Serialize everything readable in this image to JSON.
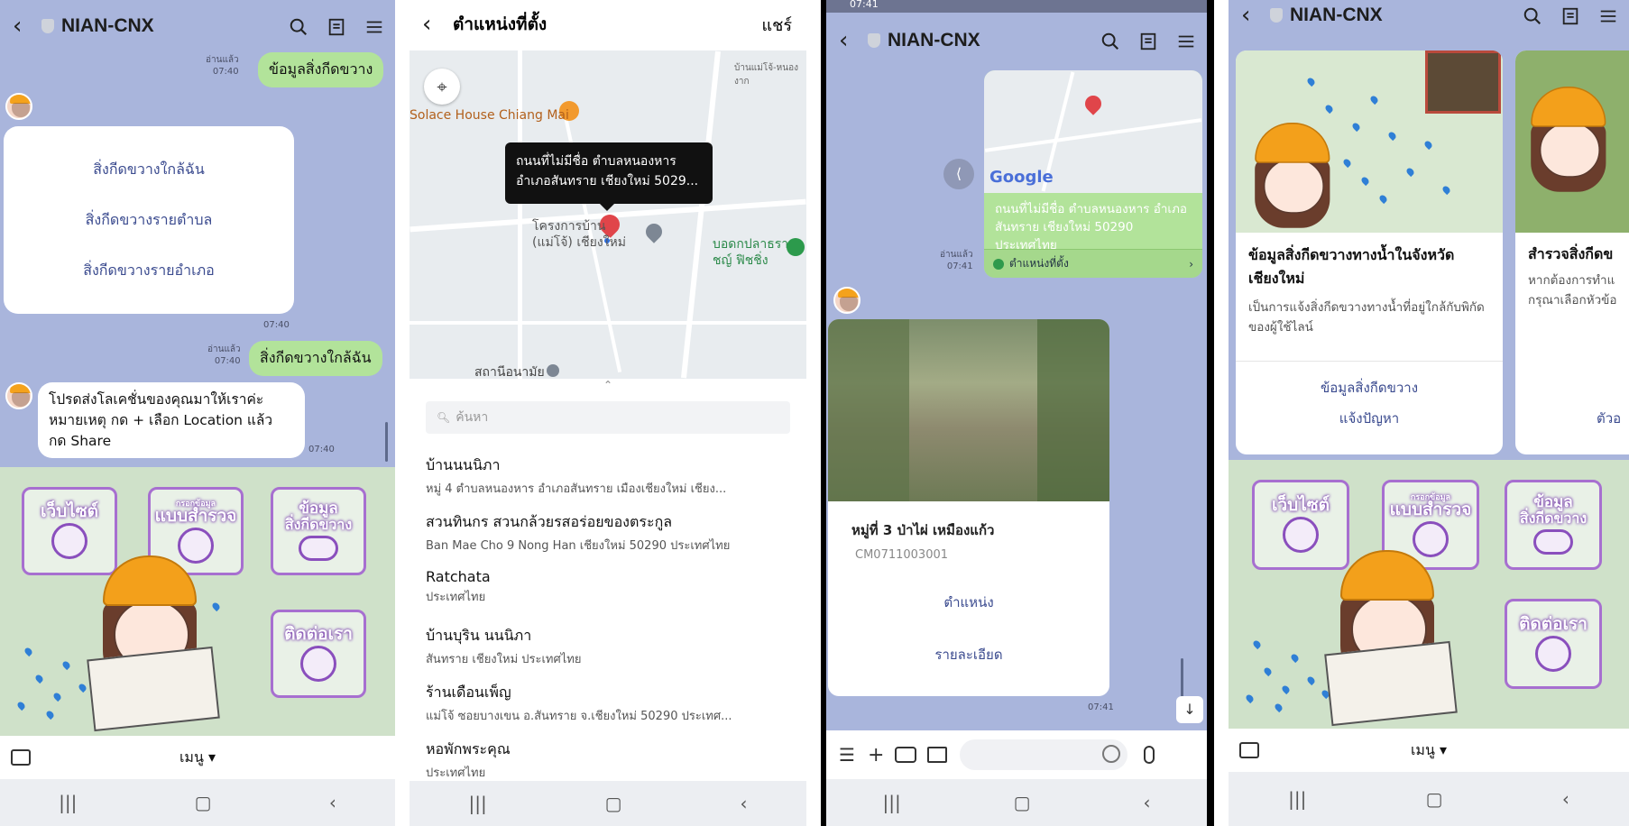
{
  "colors": {
    "chat_bg": "#a9b5dc",
    "green_bubble": "#b2e39a",
    "accent_purple": "#a76fd0",
    "link_blue": "#3b4b8f",
    "pin_red": "#e0454a"
  },
  "p1": {
    "header": {
      "title": "NIAN-CNX"
    },
    "msg_sent_1": {
      "read": "อ่านแล้ว",
      "time": "07:40",
      "text": "ข้อมูลสิ่งกีดขวาง"
    },
    "menu_card": {
      "options": [
        "สิ่งกีดขวางใกล้ฉัน",
        "สิ่งกีดขวางรายตำบล",
        "สิ่งกีดขวางรายอำเภอ"
      ],
      "time": "07:40"
    },
    "msg_sent_2": {
      "read": "อ่านแล้ว",
      "time": "07:40",
      "text": "สิ่งกีดขวางใกล้ฉัน"
    },
    "msg_recv": {
      "lines": [
        "โปรดส่งโลเคชั่นของคุณมาให้เราค่ะ",
        "หมายเหตุ กด + เลือก Location แล้ว",
        "กด Share"
      ],
      "time": "07:40"
    },
    "richmenu": {
      "website": "เว็บไซต์",
      "survey_small": "กรอกข้อมูล",
      "survey": "แบบสำรวจ",
      "obstacle_line1": "ข้อมูล",
      "obstacle_line2": "สิ่งกีดขวาง",
      "contact": "ติดต่อเรา"
    },
    "menu_label": "เมนู ▾"
  },
  "p2": {
    "header": {
      "title": "ตำแหน่งที่ตั้ง",
      "share": "แชร์"
    },
    "map": {
      "poi_top": "Solace House Chiang Mai",
      "tooltip_1": "ถนนที่ไม่มีชื่อ ตำบลหนองหาร",
      "tooltip_2": "อำเภอสันทราย เชียงใหม่ 5029...",
      "label_project": "โครงการบ้าน",
      "label_project2": "(แม่โจ้) เชียงใหม่",
      "label_right1": "บอดกปลาธรา",
      "label_right2": "ชญ์ ฟิชชิ่ง",
      "label_bottom": "สถานีอนามัย",
      "label_top_right": "บ้านแม่โจ้-หนองงาก"
    },
    "search": {
      "placeholder": "ค้นหา"
    },
    "places": [
      {
        "name": "บ้านนนนิภา",
        "addr": "หมู่ 4 ตำบลหนองหาร อำเภอสันทราย เมืองเชียงใหม่ เชียง..."
      },
      {
        "name": "สวนทินกร สวนกล้วยรสอร่อยของตระกูล",
        "addr": "Ban Mae Cho 9 Nong Han เชียงใหม่ 50290 ประเทศไทย"
      },
      {
        "name": "Ratchata",
        "addr": "ประเทศไทย"
      },
      {
        "name": "บ้านบุริน นนนิภา",
        "addr": "สันทราย เชียงใหม่ ประเทศไทย"
      },
      {
        "name": "ร้านเดือนเพ็ญ",
        "addr": "แม่โจ้ ซอยบางเขน อ.สันทราย จ.เชียงใหม่ 50290 ประเทศ..."
      },
      {
        "name": "หอพักพระคุณ",
        "addr": "ประเทศไทย"
      }
    ]
  },
  "p3": {
    "status": "07:41",
    "header": {
      "title": "NIAN-CNX"
    },
    "location_msg": {
      "read": "อ่านแล้ว",
      "time": "07:41",
      "address": "ถนนที่ไม่มีชื่อ ตำบลหนองหาร อำเภอสันทราย เชียงใหม่ 50290 ประเทศไทย",
      "footer": "ตำแหน่งที่ตั้ง",
      "google": "Google"
    },
    "result_card": {
      "title": "หมู่ที่ 3 ป่าไผ่ เหมืองแก้ว",
      "code": "CM0711003001",
      "link1": "ตำแหน่ง",
      "link2": "รายละเอียด",
      "time": "07:41"
    }
  },
  "p4": {
    "header": {
      "title": "NIAN-CNX"
    },
    "card1": {
      "title": "ข้อมูลสิ่งกีดขวางทางน้ำในจังหวัดเชียงใหม่",
      "desc": "เป็นการแจ้งสิ่งกีดขวางทางน้ำที่อยู่ใกล้กับพิกัดของผู้ใช้ไลน์",
      "link1": "ข้อมูลสิ่งกีดขวาง",
      "link2": "แจ้งปัญหา"
    },
    "card2": {
      "title": "สำรวจสิ่งกีดข",
      "desc1": "หากต้องการทำแ",
      "desc2": "กรุณาเลือกหัวข้อ",
      "link": "ตัวอ"
    },
    "richmenu": {
      "website": "เว็บไซต์",
      "survey_small": "กรอกข้อมูล",
      "survey": "แบบสำรวจ",
      "obstacle_line1": "ข้อมูล",
      "obstacle_line2": "สิ่งกีดขวาง",
      "contact": "ติดต่อเรา"
    },
    "menu_label": "เมนู ▾"
  }
}
